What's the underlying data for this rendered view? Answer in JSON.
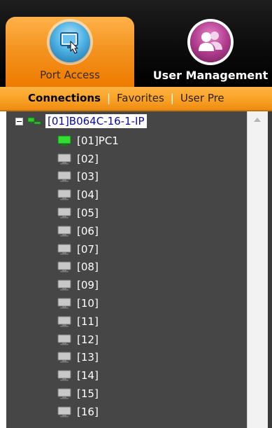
{
  "tabs": [
    {
      "label": "Port Access",
      "icon": "port-access-icon",
      "active": true
    },
    {
      "label": "User Management",
      "icon": "users-icon",
      "active": false
    }
  ],
  "subnav": {
    "items": [
      "Connections",
      "Favorites",
      "User Pre"
    ],
    "separator": "|"
  },
  "tree": {
    "root_label": "[01]B064C-16-1-IP",
    "ports": [
      {
        "label": "[01]PC1",
        "online": true
      },
      {
        "label": "[02]",
        "online": false
      },
      {
        "label": "[03]",
        "online": false
      },
      {
        "label": "[04]",
        "online": false
      },
      {
        "label": "[05]",
        "online": false
      },
      {
        "label": "[06]",
        "online": false
      },
      {
        "label": "[07]",
        "online": false
      },
      {
        "label": "[08]",
        "online": false
      },
      {
        "label": "[09]",
        "online": false
      },
      {
        "label": "[10]",
        "online": false
      },
      {
        "label": "[11]",
        "online": false
      },
      {
        "label": "[12]",
        "online": false
      },
      {
        "label": "[13]",
        "online": false
      },
      {
        "label": "[14]",
        "online": false
      },
      {
        "label": "[15]",
        "online": false
      },
      {
        "label": "[16]",
        "online": false
      }
    ]
  },
  "colors": {
    "accent": "#f49421",
    "panel": "#464646",
    "online": "#33dd33",
    "offline": "#c8c8c8"
  }
}
